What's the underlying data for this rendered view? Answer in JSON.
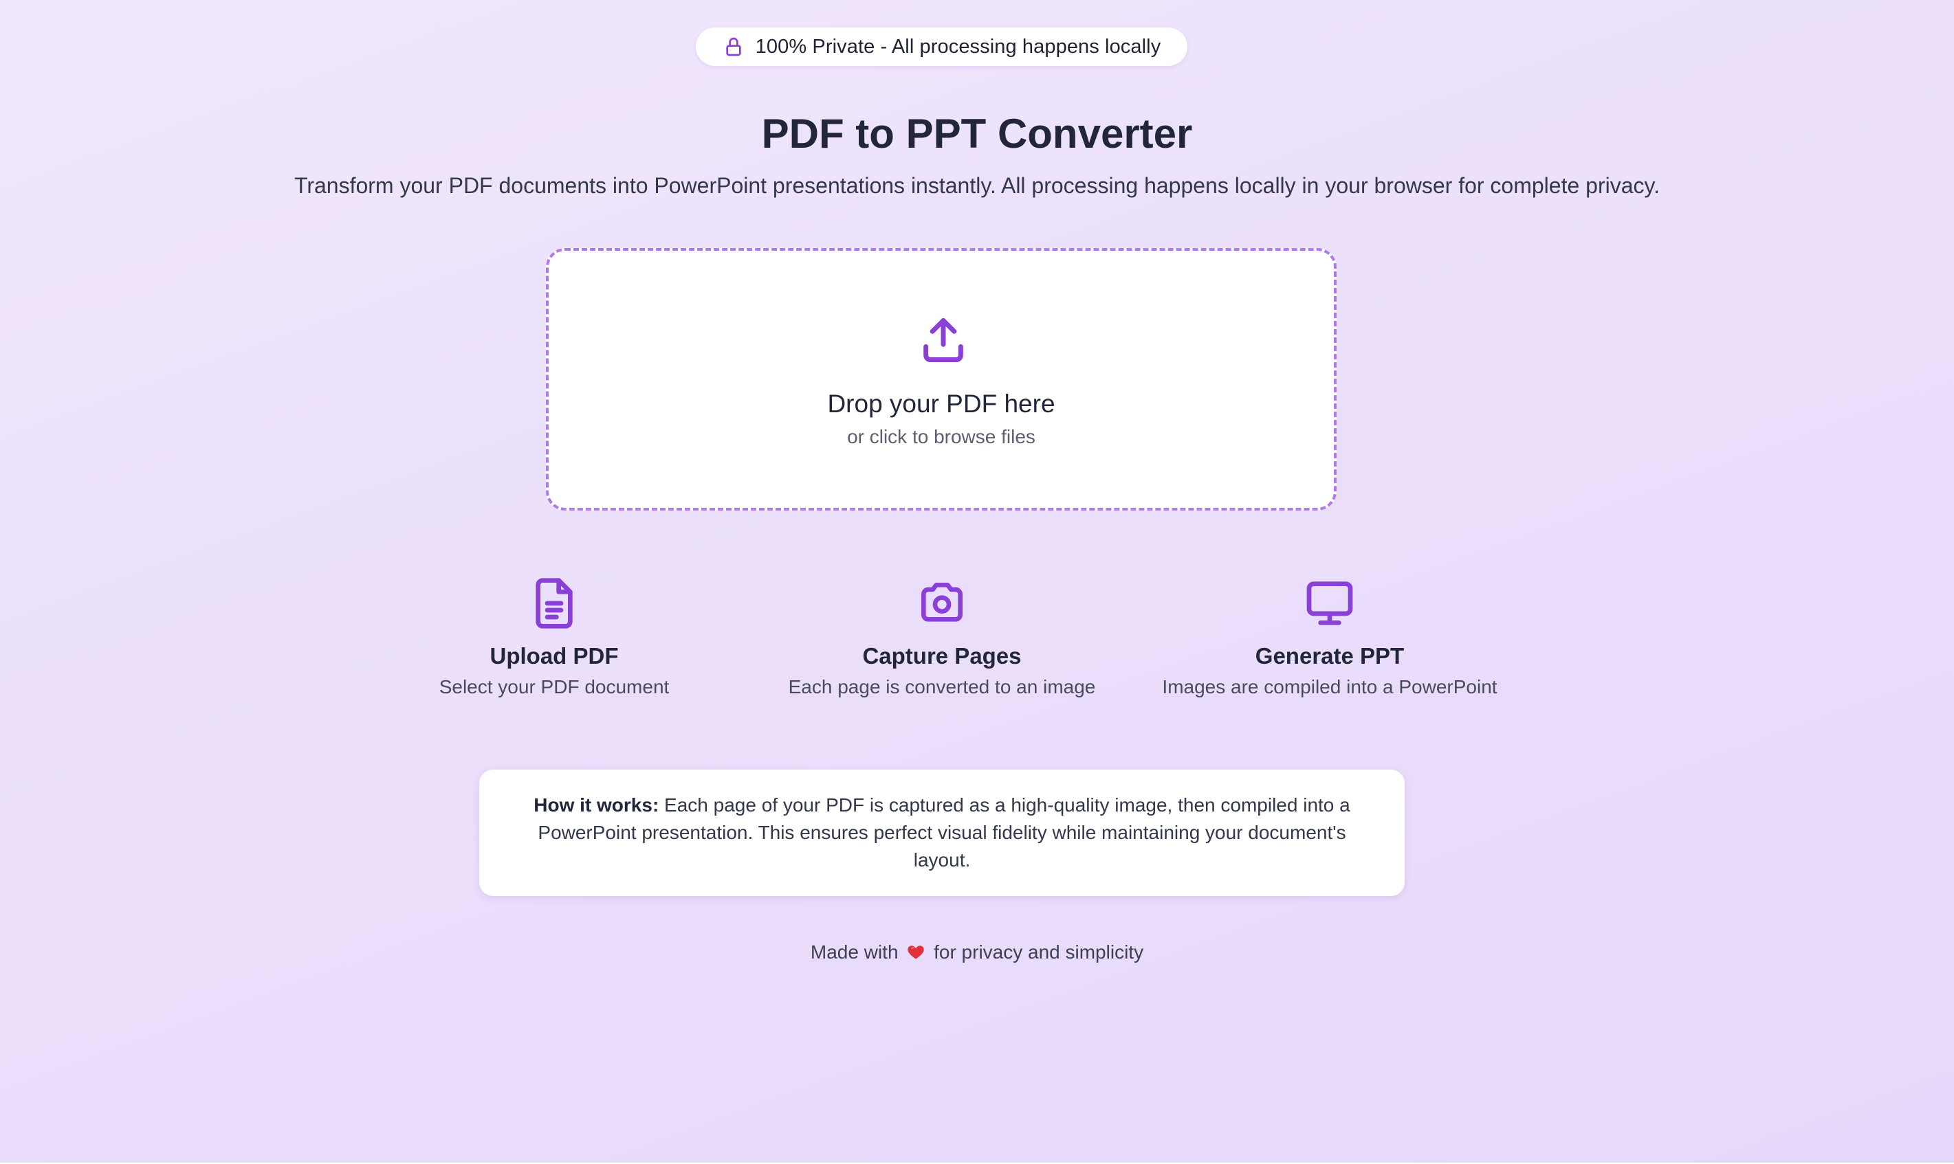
{
  "privacy_badge": {
    "icon": "lock-icon",
    "text": "100% Private - All processing happens locally"
  },
  "header": {
    "title": "PDF to PPT Converter",
    "subtitle": "Transform your PDF documents into PowerPoint presentations instantly. All processing happens locally in your browser for complete privacy."
  },
  "dropzone": {
    "icon": "upload-icon",
    "title": "Drop your PDF here",
    "subtitle": "or click to browse files"
  },
  "steps": [
    {
      "icon": "document-icon",
      "title": "Upload PDF",
      "description": "Select your PDF document"
    },
    {
      "icon": "camera-icon",
      "title": "Capture Pages",
      "description": "Each page is converted to an image"
    },
    {
      "icon": "monitor-icon",
      "title": "Generate PPT",
      "description": "Images are compiled into a PowerPoint"
    }
  ],
  "how_it_works": {
    "label": "How it works:",
    "text": "Each page of your PDF is captured as a high-quality image, then compiled into a PowerPoint presentation. This ensures perfect visual fidelity while maintaining your document's layout."
  },
  "footer": {
    "before": "Made with",
    "icon": "heart-icon",
    "after": "for privacy and simplicity"
  },
  "colors": {
    "accent": "#8a3fd6",
    "dropzone_border": "#b07be8",
    "heart": "#e0303a",
    "background": "#ebdffb"
  }
}
